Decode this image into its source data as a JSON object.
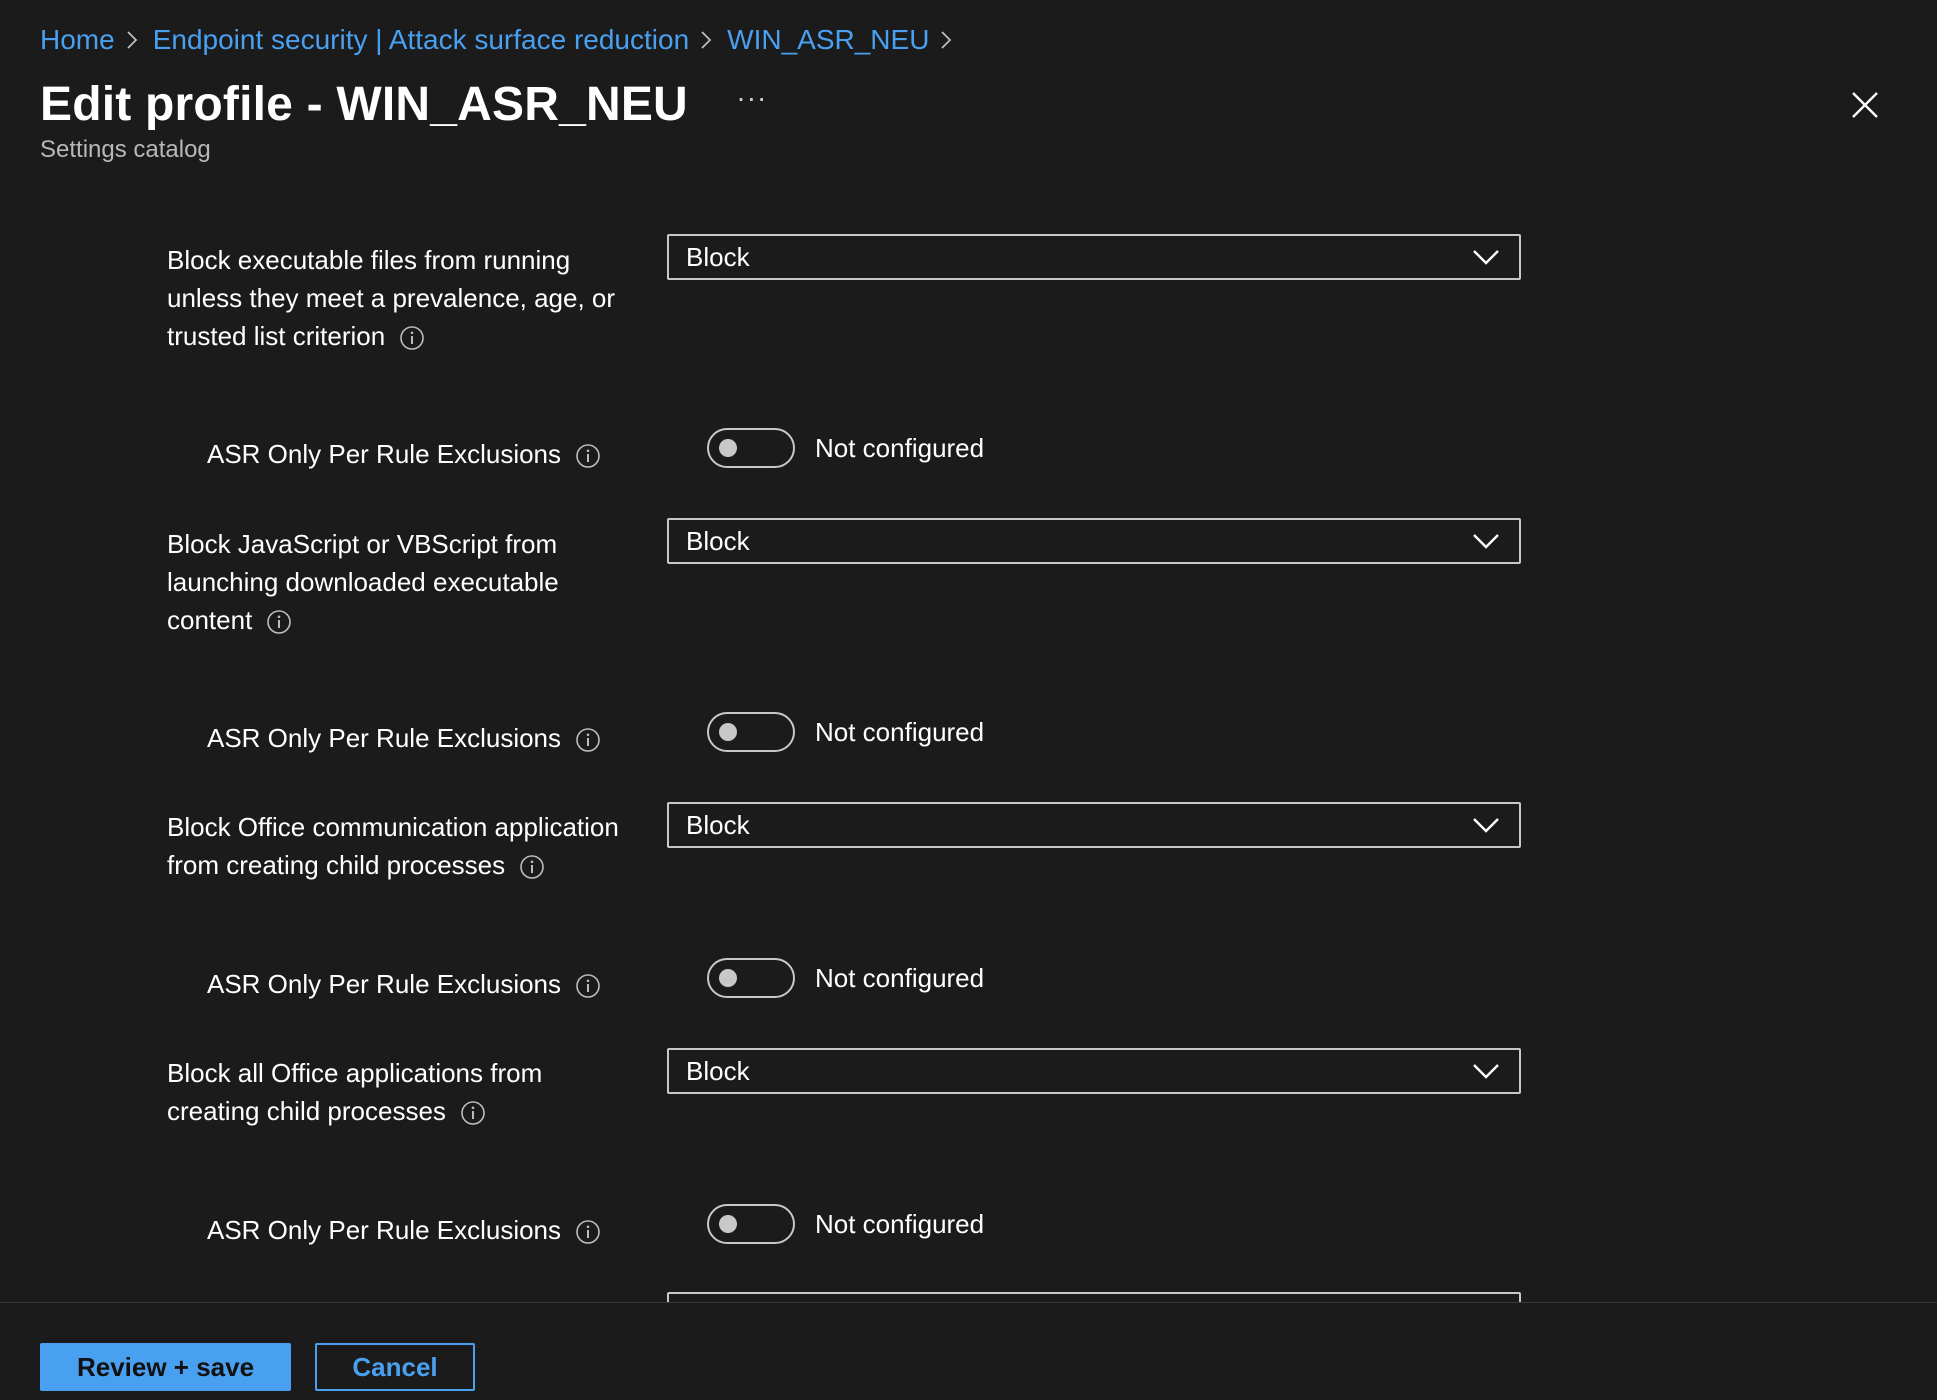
{
  "breadcrumb": {
    "items": [
      "Home",
      "Endpoint security | Attack surface reduction",
      "WIN_ASR_NEU"
    ]
  },
  "header": {
    "title": "Edit profile - WIN_ASR_NEU",
    "more_label": "···",
    "subtitle": "Settings catalog"
  },
  "settings": [
    {
      "label": "Block executable files from running unless they meet a prevalence, age, or trusted list criterion",
      "value": "Block",
      "exclusions": {
        "label": "ASR Only Per Rule Exclusions",
        "state": "Not configured"
      }
    },
    {
      "label": "Block JavaScript or VBScript from launching downloaded executable content",
      "value": "Block",
      "exclusions": {
        "label": "ASR Only Per Rule Exclusions",
        "state": "Not configured"
      }
    },
    {
      "label": "Block Office communication application from creating child processes",
      "value": "Block",
      "exclusions": {
        "label": "ASR Only Per Rule Exclusions",
        "state": "Not configured"
      }
    },
    {
      "label": "Block all Office applications from creating child processes",
      "value": "Block",
      "exclusions": {
        "label": "ASR Only Per Rule Exclusions",
        "state": "Not configured"
      }
    }
  ],
  "footer": {
    "primary_label": "Review + save",
    "secondary_label": "Cancel"
  },
  "colors": {
    "background": "#1b1b1b",
    "accent": "#4aa0f0",
    "border": "#c8c8c8",
    "subtext": "#b8b8b8"
  },
  "icons": [
    "chevron-right-icon",
    "close-icon",
    "info-icon",
    "chevron-down-icon"
  ]
}
